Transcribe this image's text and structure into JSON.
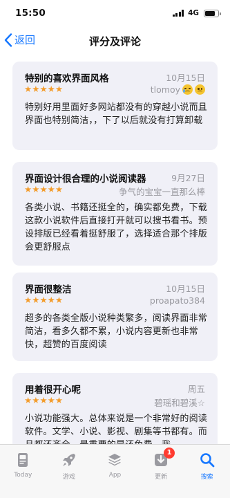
{
  "status_bar": {
    "time": "15:50",
    "network": "4G"
  },
  "nav": {
    "back_label": "返回",
    "title": "评分及评论"
  },
  "reviews": [
    {
      "title": "特别的喜欢界面风格",
      "date": "10月15日",
      "rating": 5,
      "author": "tlomoy",
      "author_emojis": [
        "crying-face",
        "worried-face"
      ],
      "body": "特别好用里面好多网站都没有的穿越小说而且界面也特别简洁，，下了以后就没有打算卸载"
    },
    {
      "title": "界面设计很合理的小说阅读器",
      "date": "9月27日",
      "rating": 5,
      "author": "争气的宝宝一直那么棒",
      "body": "各类小说、书籍还挺全的，确实都免费，下载这款小说软件后直接打开就可以搜书看书。预设排版已经看着挺舒服了，选择适合那个排版会更舒服点"
    },
    {
      "title": "界面很整洁",
      "date": "10月15日",
      "rating": 5,
      "author": "proapato384",
      "body": "超多的各类全版小说种类繁多，阅读界面非常简洁，看多久都不累，小说内容更新也非常快，超赞的百度阅读"
    },
    {
      "title": "用着很开心呢",
      "date": "周五",
      "rating": 5,
      "author": "碧瑶和碧溪☆",
      "body": "小说功能强大。总体来说是一个非常好的阅读软件。文学、小说、影视、剧集等书都有。而且都还齐全。最重要的是还免费。我"
    }
  ],
  "tabs": [
    {
      "label": "Today",
      "icon": "today-icon"
    },
    {
      "label": "游戏",
      "icon": "rocket-icon"
    },
    {
      "label": "App",
      "icon": "app-stack-icon"
    },
    {
      "label": "更新",
      "icon": "download-icon",
      "badge": "1"
    },
    {
      "label": "搜索",
      "icon": "search-icon",
      "active": true
    }
  ],
  "colors": {
    "accent": "#1677ff",
    "star": "#f39c2b",
    "card_bg": "#f0f0f7",
    "badge": "#ff3b30"
  }
}
